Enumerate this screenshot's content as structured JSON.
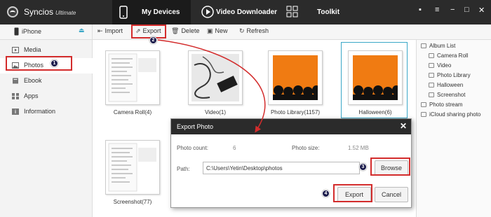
{
  "app": {
    "name": "Syncios",
    "edition": "Ultimate"
  },
  "main_tabs": [
    {
      "label": "My Devices",
      "icon": "phone-icon"
    },
    {
      "label": "Video Downloader",
      "icon": "play-icon"
    },
    {
      "label": "Toolkit",
      "icon": "toolkit-grid-icon"
    }
  ],
  "window_controls": [
    "chat-icon",
    "menu-icon",
    "minimize-icon",
    "maximize-icon",
    "close-icon"
  ],
  "device": {
    "name": "iPhone"
  },
  "toolbar": {
    "import": "Import",
    "export": "Export",
    "delete": "Delete",
    "new": "New",
    "refresh": "Refresh"
  },
  "sidebar": {
    "items": [
      {
        "label": "Media"
      },
      {
        "label": "Photos",
        "active": true
      },
      {
        "label": "Ebook"
      },
      {
        "label": "Apps"
      },
      {
        "label": "Information"
      }
    ]
  },
  "albums": [
    {
      "label": "Camera Roll(4)"
    },
    {
      "label": "Video(1)"
    },
    {
      "label": "Photo Library(1157)"
    },
    {
      "label": "Halloween(6)",
      "selected": true
    },
    {
      "label": "Screenshot(77)"
    }
  ],
  "right_panel": {
    "album_list": "Album List",
    "children": [
      "Camera Roll",
      "Video",
      "Photo Library",
      "Halloween",
      "Screenshot"
    ],
    "photo_stream": "Photo stream",
    "icloud": "iCloud sharing photo"
  },
  "dialog": {
    "title": "Export Photo",
    "photo_count_label": "Photo count:",
    "photo_count": "6",
    "photo_size_label": "Photo size:",
    "photo_size": "1.52 MB",
    "path_label": "Path:",
    "path": "C:\\Users\\Yetin\\Desktop\\photos",
    "browse": "Browse",
    "export": "Export",
    "cancel": "Cancel"
  },
  "steps": [
    "1",
    "2",
    "3",
    "4"
  ],
  "colors": {
    "titlebar": "#2b2b2b",
    "accent": "#3aa7c7",
    "callout": "#d32c2c",
    "step_badge": "#1a1a4a",
    "pumpkin": "#f07b12"
  }
}
